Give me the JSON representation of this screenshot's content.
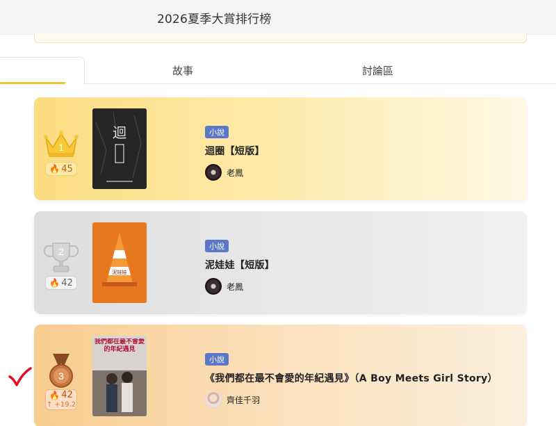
{
  "header": {
    "title": "2026夏季大賞排行榜"
  },
  "tabs": [
    {
      "label": "",
      "active": true
    },
    {
      "label": "故事",
      "active": false
    },
    {
      "label": "討論區",
      "active": false
    }
  ],
  "ranking": [
    {
      "rank": "1",
      "heat": "45",
      "badge": "小說",
      "title": "迴圈【短版】",
      "author": "老鳳",
      "cover_text": "迴",
      "rank_icon": "crown-icon",
      "accent": "#fbdc82"
    },
    {
      "rank": "2",
      "heat": "42",
      "badge": "小說",
      "title": "泥娃娃【短版】",
      "author": "老鳳",
      "cover_text": "泥娃娃",
      "rank_icon": "trophy-icon",
      "accent": "#dedede"
    },
    {
      "rank": "3",
      "heat": "42",
      "heat_delta": "↑ +19.2",
      "badge": "小說",
      "title": "《我們都在最不會愛的年紀遇見》（A Boy Meets Girl Story）",
      "author": "齊佳千羽",
      "cover_text": "我們都在最不會愛的年紀遇見",
      "rank_icon": "medal-icon",
      "accent": "#f8cc8f"
    }
  ],
  "colors": {
    "badge": "#5b78c8",
    "tab_underline": "#f2c232",
    "flame": "#f0542f",
    "checkmark": "#e0102a"
  }
}
